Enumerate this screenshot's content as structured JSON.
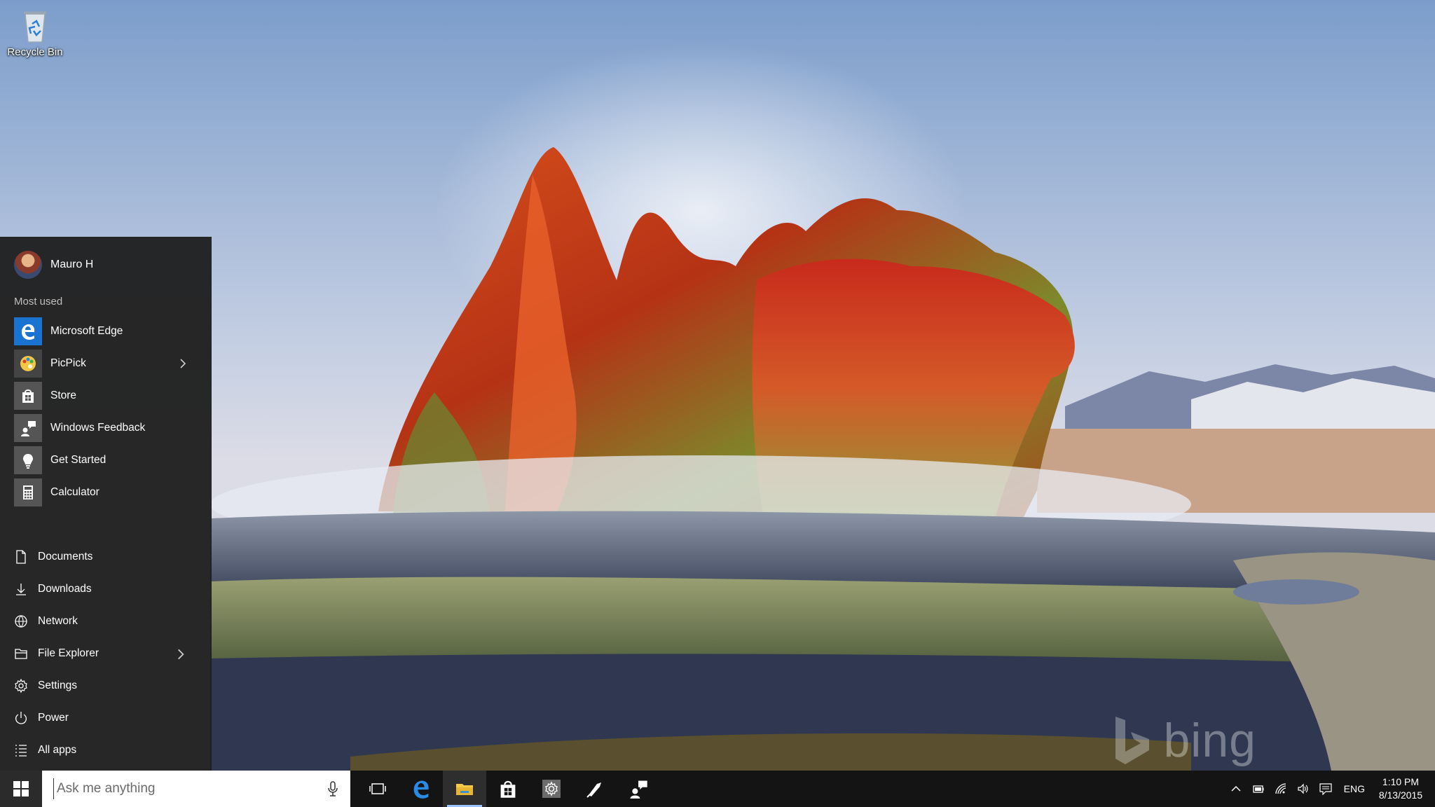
{
  "desktop": {
    "icons": [
      {
        "label": "Recycle Bin",
        "icon": "recycle-bin-icon"
      }
    ],
    "watermark": "bing"
  },
  "start_menu": {
    "user": {
      "name": "Mauro H"
    },
    "most_used_label": "Most used",
    "apps": [
      {
        "label": "Microsoft Edge",
        "icon": "edge-icon",
        "tile_color": "#1a73d0",
        "has_submenu": false
      },
      {
        "label": "PicPick",
        "icon": "picpick-icon",
        "tile_color": "#444444",
        "has_submenu": true
      },
      {
        "label": "Store",
        "icon": "store-icon",
        "tile_color": "#555555",
        "has_submenu": false
      },
      {
        "label": "Windows Feedback",
        "icon": "feedback-icon",
        "tile_color": "#555555",
        "has_submenu": false
      },
      {
        "label": "Get Started",
        "icon": "lightbulb-icon",
        "tile_color": "#555555",
        "has_submenu": false
      },
      {
        "label": "Calculator",
        "icon": "calculator-icon",
        "tile_color": "#555555",
        "has_submenu": false
      }
    ],
    "places": [
      {
        "label": "Documents",
        "icon": "document-icon",
        "has_submenu": false
      },
      {
        "label": "Downloads",
        "icon": "download-icon",
        "has_submenu": false
      },
      {
        "label": "Network",
        "icon": "network-icon",
        "has_submenu": false
      },
      {
        "label": "File Explorer",
        "icon": "file-explorer-icon",
        "has_submenu": true
      },
      {
        "label": "Settings",
        "icon": "gear-icon",
        "has_submenu": false
      },
      {
        "label": "Power",
        "icon": "power-icon",
        "has_submenu": false
      },
      {
        "label": "All apps",
        "icon": "all-apps-icon",
        "has_submenu": false
      }
    ]
  },
  "taskbar": {
    "search": {
      "placeholder": "Ask me anything",
      "value": ""
    },
    "pinned": [
      {
        "name": "task-view",
        "icon": "task-view-icon"
      },
      {
        "name": "edge",
        "icon": "edge-icon"
      },
      {
        "name": "file-explorer",
        "icon": "folder-icon",
        "active": true
      },
      {
        "name": "store",
        "icon": "store-icon"
      },
      {
        "name": "settings",
        "icon": "gear-icon"
      },
      {
        "name": "picpick",
        "icon": "picpick-icon"
      },
      {
        "name": "windows-feedback",
        "icon": "feedback-icon"
      }
    ],
    "tray": {
      "language": "ENG",
      "time": "1:10 PM",
      "date": "8/13/2015"
    }
  },
  "colors": {
    "start_bg": "#1f1f1f",
    "taskbar_bg": "#141414",
    "accent": "#1a73d0"
  }
}
